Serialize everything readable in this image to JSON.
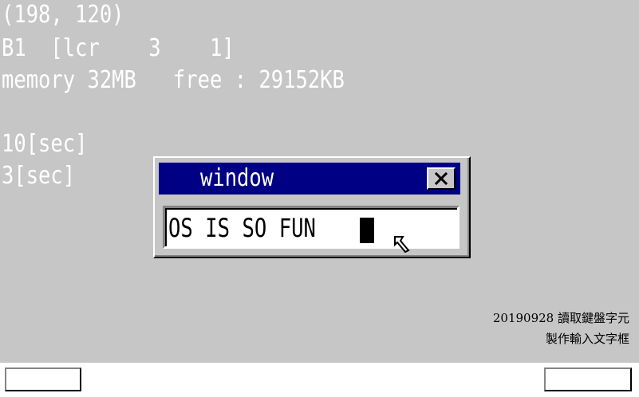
{
  "console": {
    "lines": [
      "(198, 120)",
      "B1  [lcr    3    1]",
      "memory 32MB   free : 29152KB",
      "10[sec]",
      "3[sec]"
    ]
  },
  "window": {
    "title": "window",
    "close_icon": "close-x-icon",
    "input_value": "OS IS SO FUN"
  },
  "annotation": {
    "line1": "20190928 讀取鍵盤字元",
    "line2": "製作輸入文字框"
  },
  "colors": {
    "desktop": "#c6c6c6",
    "titlebar": "#000084",
    "console_text": "#ffffff",
    "taskbar": "#ffffff"
  }
}
